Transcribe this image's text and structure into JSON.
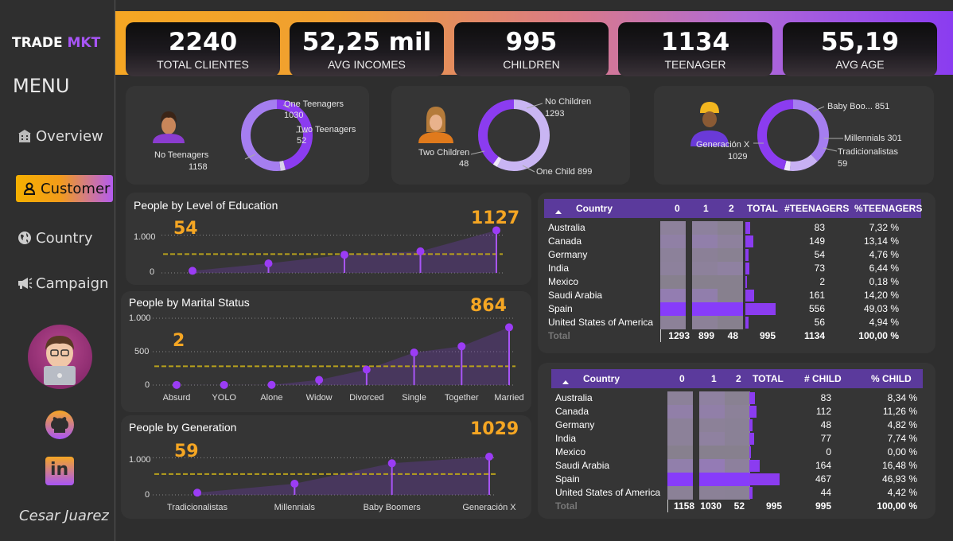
{
  "sidebar": {
    "logo_a": "TRADE ",
    "logo_b": "MKT",
    "menu": "MENU",
    "items": [
      {
        "label": "Overview",
        "icon": "building-icon"
      },
      {
        "label": "Customer",
        "icon": "user-icon"
      },
      {
        "label": "Country",
        "icon": "globe-icon"
      },
      {
        "label": "Campaign",
        "icon": "megaphone-icon"
      }
    ],
    "author": "Cesar Juarez",
    "linkedin": "in"
  },
  "colors": {
    "accent": "#f5a623",
    "purple": "#8b3cf0",
    "header": "#5b3a9c"
  },
  "kpis": [
    {
      "value": "2240",
      "label": "TOTAL CLIENTES"
    },
    {
      "value": "52,25 mil",
      "label": "AVG INCOMES"
    },
    {
      "value": "995",
      "label": "CHILDREN"
    },
    {
      "value": "1134",
      "label": "TEENAGER"
    },
    {
      "value": "55,19",
      "label": "AVG AGE"
    }
  ],
  "donuts": [
    {
      "labels": {
        "a": "One Teenagers",
        "a2": "1030",
        "b": "Two Teenagers",
        "b2": "52",
        "c": "No Teenagers",
        "c2": "1158"
      },
      "values": [
        1030,
        52,
        1158
      ]
    },
    {
      "labels": {
        "a": "No Children",
        "a2": "1293",
        "b": "Two Children",
        "b2": "48",
        "c": "One Child 899"
      },
      "values": [
        1293,
        48,
        899
      ]
    },
    {
      "labels": {
        "a": "Baby Boo... 851",
        "b": "Millennials 301",
        "c": "Tradicionalistas",
        "c2": "59",
        "d": "Generación X",
        "d2": "1029"
      },
      "values": [
        851,
        301,
        59,
        1029
      ]
    }
  ],
  "chart_data": [
    {
      "type": "lollipop",
      "title": "People by Level of Education",
      "highlight_min": "54",
      "highlight_max": "1127",
      "ytick_labels": [
        "1.000",
        "0"
      ],
      "values": [
        54,
        250,
        480,
        570,
        1127
      ],
      "ylim": [
        0,
        1200
      ]
    },
    {
      "type": "lollipop",
      "title": "People by Marital Status",
      "highlight_min": "2",
      "highlight_max": "864",
      "ytick_labels": [
        "1.000",
        "500",
        "0"
      ],
      "categories": [
        "Absurd",
        "YOLO",
        "Alone",
        "Widow",
        "Divorced",
        "Single",
        "Together",
        "Married"
      ],
      "values": [
        2,
        2,
        3,
        77,
        232,
        487,
        580,
        864
      ],
      "ylim": [
        0,
        1000
      ]
    },
    {
      "type": "lollipop",
      "title": "People by Generation",
      "highlight_min": "59",
      "highlight_max": "1029",
      "ytick_labels": [
        "1.000",
        "0"
      ],
      "categories": [
        "Tradicionalistas",
        "Millennials",
        "Baby Boomers",
        "Generación X"
      ],
      "values": [
        59,
        301,
        851,
        1029
      ],
      "ylim": [
        0,
        1200
      ]
    }
  ],
  "table1": {
    "headers": [
      "Country",
      "0",
      "1",
      "2",
      "TOTAL",
      "#TEENAGERS",
      "%TEENAGERS"
    ],
    "rows": [
      {
        "country": "Australia",
        "n": "83",
        "p": "7,32 %",
        "v0": 69,
        "v1": 83,
        "v2": 1
      },
      {
        "country": "Canada",
        "n": "149",
        "p": "13,14 %",
        "v0": 119,
        "v1": 149,
        "v2": 4
      },
      {
        "country": "Germany",
        "n": "54",
        "p": "4,76 %",
        "v0": 66,
        "v1": 54,
        "v2": 1
      },
      {
        "country": "India",
        "n": "73",
        "p": "6,44 %",
        "v0": 75,
        "v1": 73,
        "v2": 5
      },
      {
        "country": "Mexico",
        "n": "2",
        "p": "0,18 %",
        "v0": 1,
        "v1": 2,
        "v2": 0
      },
      {
        "country": "Saudi Arabia",
        "n": "161",
        "p": "14,20 %",
        "v0": 176,
        "v1": 161,
        "v2": 0
      },
      {
        "country": "Spain",
        "n": "556",
        "p": "49,03 %",
        "v0": 538,
        "v1": 556,
        "v2": 28
      },
      {
        "country": "United States of America",
        "n": "56",
        "p": "4,94 %",
        "v0": 53,
        "v1": 56,
        "v2": 0
      }
    ],
    "total": {
      "label": "Total",
      "c0": "1293",
      "c1": "899",
      "c2": "48",
      "t": "995",
      "n": "1134",
      "p": "100,00 %"
    }
  },
  "table2": {
    "headers": [
      "Country",
      "0",
      "1",
      "2",
      "TOTAL",
      "# CHILD",
      "% CHILD"
    ],
    "rows": [
      {
        "country": "Australia",
        "n": "83",
        "p": "8,34 %",
        "v0": 69,
        "v1": 80,
        "v2": 1
      },
      {
        "country": "Canada",
        "n": "112",
        "p": "11,26 %",
        "v0": 156,
        "v1": 109,
        "v2": 3
      },
      {
        "country": "Germany",
        "n": "48",
        "p": "4,82 %",
        "v0": 72,
        "v1": 46,
        "v2": 2
      },
      {
        "country": "India",
        "n": "77",
        "p": "7,74 %",
        "v0": 71,
        "v1": 75,
        "v2": 2
      },
      {
        "country": "Mexico",
        "n": "0",
        "p": "0,00 %",
        "v0": 3,
        "v1": 0,
        "v2": 0
      },
      {
        "country": "Saudi Arabia",
        "n": "164",
        "p": "16,48 %",
        "v0": 173,
        "v1": 160,
        "v2": 4
      },
      {
        "country": "Spain",
        "n": "467",
        "p": "46,93 %",
        "v0": 627,
        "v1": 441,
        "v2": 26
      },
      {
        "country": "United States of America",
        "n": "44",
        "p": "4,42 %",
        "v0": 55,
        "v1": 42,
        "v2": 2
      }
    ],
    "total": {
      "label": "Total",
      "c0": "1158",
      "c1": "1030",
      "c2": "52",
      "t": "995",
      "n": "995",
      "p": "100,00 %"
    }
  }
}
